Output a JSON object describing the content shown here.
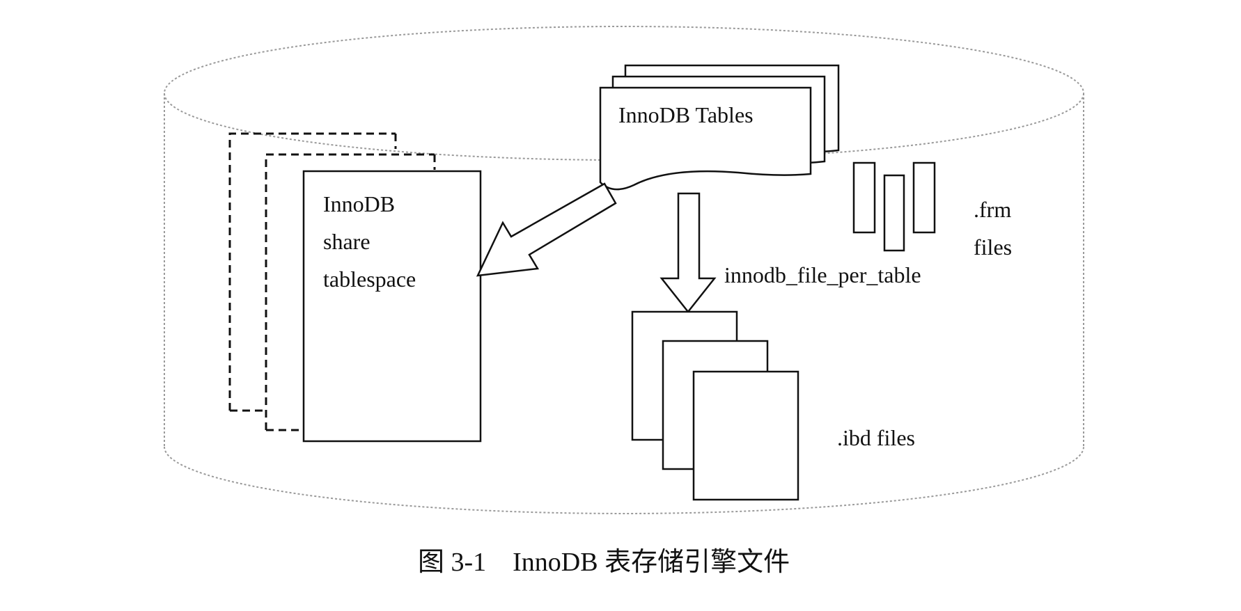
{
  "diagram": {
    "shared_tablespace_label": [
      "InnoDB",
      "share",
      "tablespace"
    ],
    "tables_label": "InnoDB Tables",
    "file_per_table_label": "innodb_file_per_table",
    "frm_label": [
      ".frm",
      "files"
    ],
    "ibd_label": ".ibd files"
  },
  "caption": "图 3-1    InnoDB 表存储引擎文件"
}
